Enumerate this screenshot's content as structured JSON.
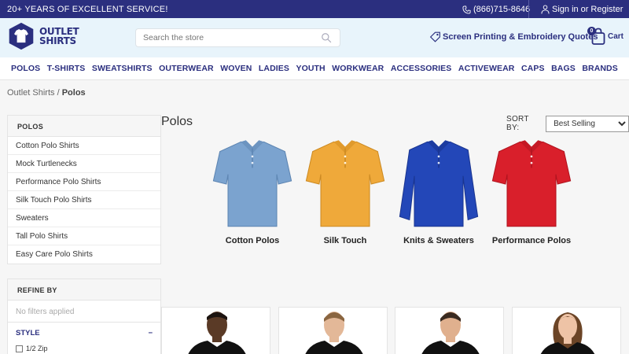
{
  "topbar": {
    "promo": "20+ YEARS OF EXCELLENT SERVICE!",
    "phone": "(866)715-8646",
    "sign_in": "Sign in",
    "or": "or",
    "register": "Register"
  },
  "header": {
    "logo_line1": "OUTLET",
    "logo_line2": "SHIRTS",
    "search_placeholder": "Search the store",
    "quotes_label": "Screen Printing & Embroidery Quotes",
    "cart_label": "Cart",
    "cart_count": "0"
  },
  "nav": [
    "POLOS",
    "T-SHIRTS",
    "SWEATSHIRTS",
    "OUTERWEAR",
    "WOVEN",
    "LADIES",
    "YOUTH",
    "WORKWEAR",
    "ACCESSORIES",
    "ACTIVEWEAR",
    "CAPS",
    "BAGS",
    "BRANDS"
  ],
  "breadcrumb": {
    "root": "Outlet Shirts",
    "separator": "/",
    "current": "Polos"
  },
  "sidebar": {
    "heading": "POLOS",
    "items": [
      "Cotton Polo Shirts",
      "Mock Turtlenecks",
      "Performance Polo Shirts",
      "Silk Touch Polo Shirts",
      "Sweaters",
      "Tall Polo Shirts",
      "Easy Care Polo Shirts"
    ]
  },
  "refine": {
    "heading": "REFINE BY",
    "empty": "No filters applied",
    "style_label": "STYLE",
    "collapse": "−",
    "options": [
      "1/2 Zip"
    ]
  },
  "main": {
    "title": "Polos",
    "sort_label": "SORT BY:",
    "sort_value": "Best Selling"
  },
  "categories": [
    {
      "name": "Cotton Polos",
      "color": "#7ba3cf"
    },
    {
      "name": "Silk Touch",
      "color": "#efa93a"
    },
    {
      "name": "Knits & Sweaters",
      "color": "#2347b8"
    },
    {
      "name": "Performance Polos",
      "color": "#d91f2b"
    }
  ],
  "colors": {
    "brand": "#2b2f7f",
    "header_bg": "#e8f4fb"
  }
}
